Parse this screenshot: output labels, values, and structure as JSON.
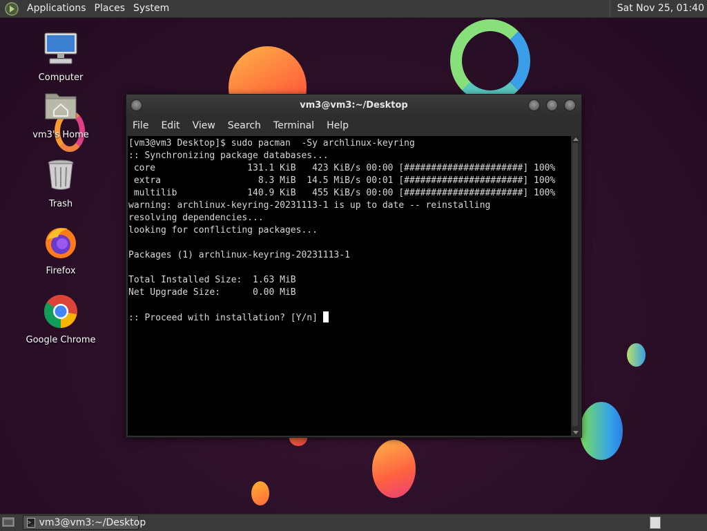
{
  "top_panel": {
    "menus": [
      "Applications",
      "Places",
      "System"
    ],
    "clock": "Sat Nov 25, 01:40"
  },
  "desktop_icons": [
    {
      "label": "Computer",
      "icon": "computer-icon"
    },
    {
      "label": "vm3's Home",
      "icon": "home-folder-icon"
    },
    {
      "label": "Trash",
      "icon": "trash-icon"
    },
    {
      "label": "Firefox",
      "icon": "firefox-icon"
    },
    {
      "label": "Google Chrome",
      "icon": "chrome-icon"
    }
  ],
  "window": {
    "title": "vm3@vm3:~/Desktop",
    "menu": [
      "File",
      "Edit",
      "View",
      "Search",
      "Terminal",
      "Help"
    ]
  },
  "terminal": {
    "lines": [
      "[vm3@vm3 Desktop]$ sudo pacman  -Sy archlinux-keyring",
      ":: Synchronizing package databases...",
      " core                 131.1 KiB   423 KiB/s 00:00 [######################] 100%",
      " extra                  8.3 MiB  14.5 MiB/s 00:01 [######################] 100%",
      " multilib             140.9 KiB   455 KiB/s 00:00 [######################] 100%",
      "warning: archlinux-keyring-20231113-1 is up to date -- reinstalling",
      "resolving dependencies...",
      "looking for conflicting packages...",
      "",
      "Packages (1) archlinux-keyring-20231113-1",
      "",
      "Total Installed Size:  1.63 MiB",
      "Net Upgrade Size:      0.00 MiB",
      "",
      ":: Proceed with installation? [Y/n] "
    ]
  },
  "taskbar": {
    "task_label": "vm3@vm3:~/Desktop"
  }
}
